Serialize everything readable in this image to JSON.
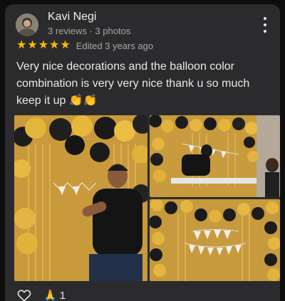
{
  "reviewer": {
    "name": "Kavi Negi",
    "meta": "3 reviews · 3 photos"
  },
  "rating": {
    "stars": 5,
    "max": 5,
    "star_color": "#fbbc04",
    "edited_label": "Edited 3 years ago"
  },
  "review": {
    "text": "Very nice decorations and the balloon color combination is very very nice thank u so much keep it up",
    "emoji": "👏👏"
  },
  "photos": [
    {
      "name": "review-photo-1",
      "description_icon": "photo"
    },
    {
      "name": "review-photo-2",
      "description_icon": "photo"
    },
    {
      "name": "review-photo-3",
      "description_icon": "photo"
    }
  ],
  "actions": {
    "like_icon": "heart-outline-icon",
    "reaction_emoji": "🙏",
    "reaction_count": "1"
  },
  "colors": {
    "card_bg": "#2b2b2d",
    "page_bg": "#0e0e0e",
    "secondary_text": "#a7a7a7"
  }
}
